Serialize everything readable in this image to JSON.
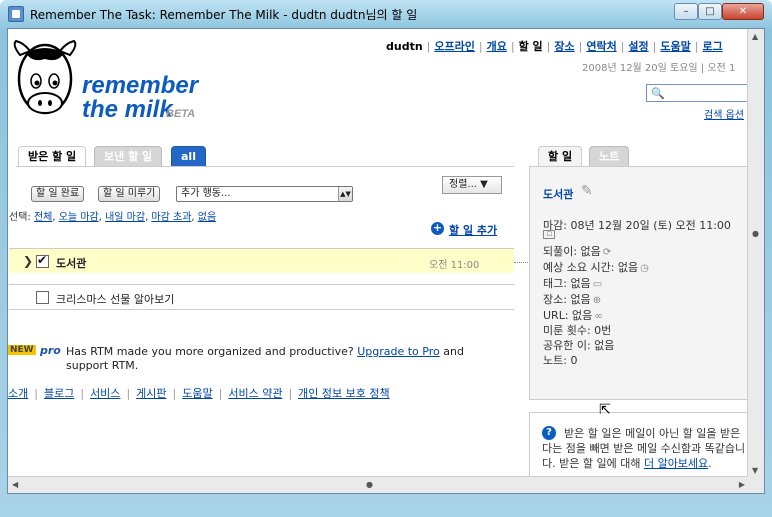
{
  "window": {
    "title": "Remember The Task: Remember The Milk - dudtn dudtn님의 할 일"
  },
  "logo": {
    "line1": "remember",
    "line2": "the milk",
    "badge": "BETA",
    "tm": "™"
  },
  "topnav": {
    "user": "dudtn",
    "items": [
      "오프라인",
      "개요",
      "할 일",
      "장소",
      "연락처",
      "설정",
      "도움말",
      "로그"
    ],
    "current_index": 2
  },
  "date": "2008년 12월 20일 토요일 | 오전 1",
  "search": {
    "link": "검색 옵션"
  },
  "left_tabs": [
    "받은 할 일",
    "보낸 할 일",
    "all"
  ],
  "toolbar": {
    "complete": "할 일 완료",
    "postpone": "할 일 미루기",
    "actions": "추가 행동...",
    "sort": "정렬..."
  },
  "selectline": {
    "prefix": "선택:",
    "options": [
      "전체",
      "오늘 마감",
      "내일 마감",
      "마감 초과",
      "없음"
    ]
  },
  "add_task": "할 일 추가",
  "tasks": [
    {
      "name": "도서관",
      "time": "오전 11:00",
      "checked": true,
      "selected": true
    },
    {
      "name": "크리스마스 선물 알아보기",
      "time": "",
      "checked": false,
      "selected": false
    }
  ],
  "promo": {
    "new_badge": "NEW",
    "pro_badge": "pro",
    "text": "Has RTM made you more organized and productive?",
    "link": "Upgrade to Pro",
    "tail": "and support RTM."
  },
  "footer": [
    "소개",
    "블로그",
    "서비스",
    "게시판",
    "도움말",
    "서비스 약관",
    "개인 정보 보호 정책"
  ],
  "right_tabs": [
    "할 일",
    "노트"
  ],
  "detail": {
    "title": "도서관",
    "props": [
      "마감: 08년 12월 20일 (토) 오전 11:00",
      "되풀이: 없음",
      "예상 소요 시간: 없음",
      "태그: 없음",
      "장소: 없음",
      "URL: 없음",
      "미룬 횟수: 0번",
      "공유한 이: 없음",
      "노트: 0"
    ]
  },
  "help": {
    "text": "받은 할 일은 메일이 아닌 할 일을 받은 다는 점을 빼면 받은 메일 수신함과 똑같습니다. 받은 할 일에 대해",
    "link": "더 알아보세요",
    "end": "."
  },
  "colors": {
    "link": "#0046a8",
    "tab_all": "#2467c4",
    "selected_row": "#fffdc8"
  }
}
